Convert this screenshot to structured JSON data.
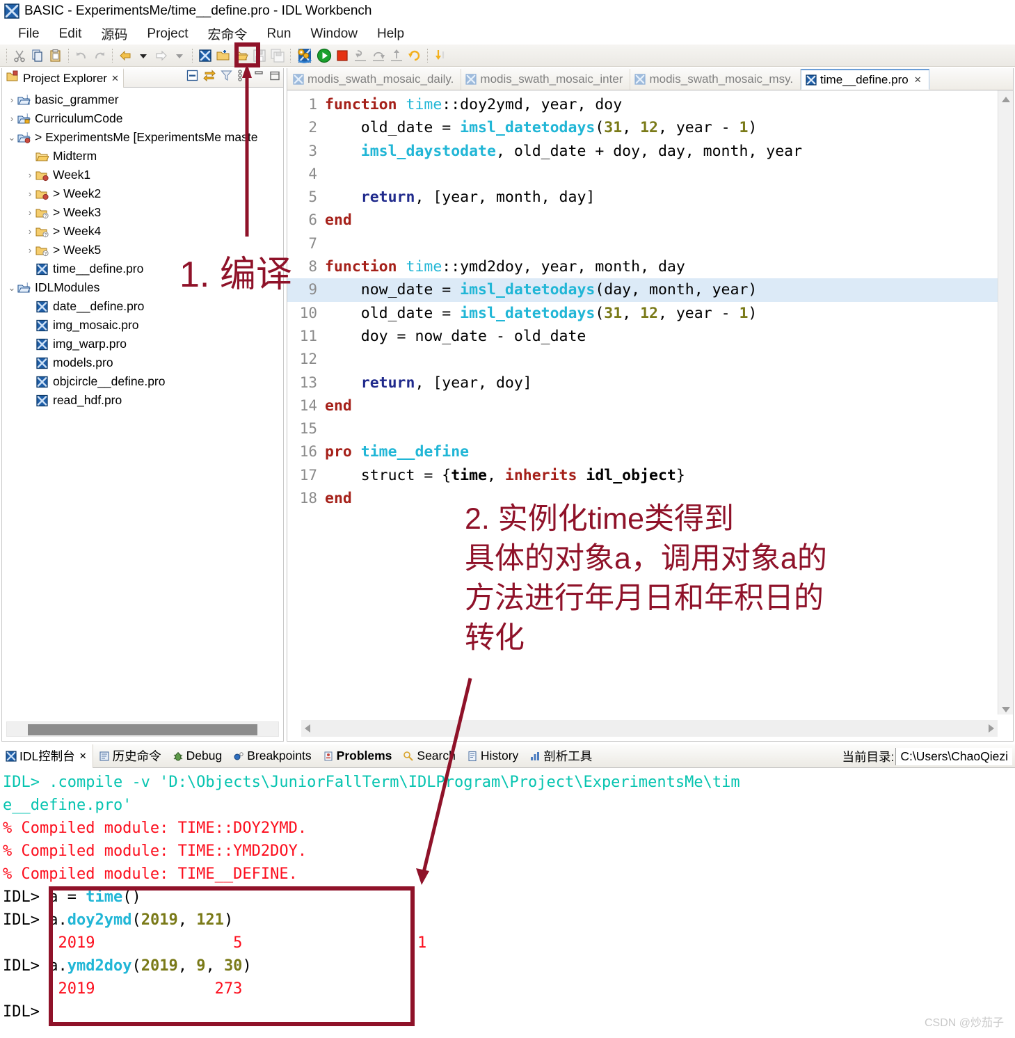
{
  "window": {
    "title": "BASIC - ExperimentsMe/time__define.pro - IDL Workbench",
    "app_icon": "idl-workbench-icon"
  },
  "menubar": {
    "items": [
      {
        "label": "File",
        "name": "menu-file"
      },
      {
        "label": "Edit",
        "name": "menu-edit"
      },
      {
        "label": "源码",
        "name": "menu-source"
      },
      {
        "label": "Project",
        "name": "menu-project"
      },
      {
        "label": "宏命令",
        "name": "menu-macro"
      },
      {
        "label": "Run",
        "name": "menu-run"
      },
      {
        "label": "Window",
        "name": "menu-window"
      },
      {
        "label": "Help",
        "name": "menu-help"
      }
    ]
  },
  "toolbar": {
    "highlight_color": "#8f1229",
    "buttons": [
      {
        "name": "cut-icon"
      },
      {
        "name": "copy-icon"
      },
      {
        "name": "paste-icon"
      },
      {
        "name": "undo-icon"
      },
      {
        "name": "redo-icon"
      },
      {
        "name": "back-arrow-icon"
      },
      {
        "name": "back-dropdown-icon"
      },
      {
        "name": "forward-arrow-icon"
      },
      {
        "name": "forward-dropdown-icon"
      },
      {
        "name": "idl-file-icon"
      },
      {
        "name": "new-project-icon"
      },
      {
        "name": "open-folder-icon"
      },
      {
        "name": "save-icon"
      },
      {
        "name": "save-all-icon"
      },
      {
        "name": "compile-icon"
      },
      {
        "name": "run-icon"
      },
      {
        "name": "stop-icon"
      },
      {
        "name": "step-into-icon"
      },
      {
        "name": "step-over-icon"
      },
      {
        "name": "step-return-icon"
      },
      {
        "name": "reset-icon"
      },
      {
        "name": "download-icon"
      }
    ]
  },
  "explorer": {
    "tab_label": "Project Explorer",
    "tab_close": "✕",
    "toolbar_icons": [
      {
        "name": "collapse-all-icon"
      },
      {
        "name": "link-with-editor-icon"
      },
      {
        "name": "filter-icon"
      },
      {
        "name": "view-menu-icon"
      },
      {
        "name": "minimize-view-icon"
      },
      {
        "name": "maximize-view-icon"
      }
    ],
    "tree": [
      {
        "label": "basic_grammer",
        "arrow": "›",
        "indent": 0,
        "icon": "idl-project-icon"
      },
      {
        "label": "CurriculumCode",
        "arrow": "›",
        "indent": 0,
        "icon": "idl-project-locked-icon"
      },
      {
        "label": "> ExperimentsMe [ExperimentsMe maste",
        "arrow": "⌄",
        "indent": 0,
        "icon": "idl-project-git-icon"
      },
      {
        "label": "Midterm",
        "arrow": "",
        "indent": 1,
        "icon": "folder-icon"
      },
      {
        "label": "Week1",
        "arrow": "›",
        "indent": 1,
        "icon": "folder-git-icon"
      },
      {
        "label": "> Week2",
        "arrow": "›",
        "indent": 1,
        "icon": "folder-git-icon"
      },
      {
        "label": "> Week3",
        "arrow": "›",
        "indent": 1,
        "icon": "folder-git-q-icon"
      },
      {
        "label": "> Week4",
        "arrow": "›",
        "indent": 1,
        "icon": "folder-git-q-icon"
      },
      {
        "label": "> Week5",
        "arrow": "›",
        "indent": 1,
        "icon": "folder-git-q-icon"
      },
      {
        "label": "time__define.pro",
        "arrow": "",
        "indent": 1,
        "icon": "pro-file-icon"
      },
      {
        "label": "IDLModules",
        "arrow": "⌄",
        "indent": 0,
        "icon": "idl-project-icon"
      },
      {
        "label": "date__define.pro",
        "arrow": "",
        "indent": 1,
        "icon": "pro-file-icon"
      },
      {
        "label": "img_mosaic.pro",
        "arrow": "",
        "indent": 1,
        "icon": "pro-file-icon"
      },
      {
        "label": "img_warp.pro",
        "arrow": "",
        "indent": 1,
        "icon": "pro-file-icon"
      },
      {
        "label": "models.pro",
        "arrow": "",
        "indent": 1,
        "icon": "pro-file-icon"
      },
      {
        "label": "objcircle__define.pro",
        "arrow": "",
        "indent": 1,
        "icon": "pro-file-icon"
      },
      {
        "label": "read_hdf.pro",
        "arrow": "",
        "indent": 1,
        "icon": "pro-file-icon"
      }
    ]
  },
  "editor": {
    "tabs": [
      {
        "label": "modis_swath_mosaic_daily.",
        "active": false,
        "close": ""
      },
      {
        "label": "modis_swath_mosaic_inter",
        "active": false,
        "close": ""
      },
      {
        "label": "modis_swath_mosaic_msy.",
        "active": false,
        "close": ""
      },
      {
        "label": "time__define.pro",
        "active": true,
        "close": "✕"
      }
    ],
    "highlight_line": 9,
    "lines": [
      {
        "n": "1",
        "tokens": [
          {
            "t": "function",
            "c": "kw"
          },
          {
            "t": " ",
            "c": ""
          },
          {
            "t": "time",
            "c": "cls"
          },
          {
            "t": "::doy2ymd, year, doy",
            "c": ""
          }
        ]
      },
      {
        "n": "2",
        "tokens": [
          {
            "t": "    old_date = ",
            "c": ""
          },
          {
            "t": "imsl_datetodays",
            "c": "fn"
          },
          {
            "t": "(",
            "c": ""
          },
          {
            "t": "31",
            "c": "num"
          },
          {
            "t": ", ",
            "c": ""
          },
          {
            "t": "12",
            "c": "num"
          },
          {
            "t": ", year - ",
            "c": ""
          },
          {
            "t": "1",
            "c": "num"
          },
          {
            "t": ")",
            "c": ""
          }
        ]
      },
      {
        "n": "3",
        "tokens": [
          {
            "t": "    ",
            "c": ""
          },
          {
            "t": "imsl_daystodate",
            "c": "fn"
          },
          {
            "t": ", old_date + doy, day, month, year",
            "c": ""
          }
        ]
      },
      {
        "n": "4",
        "tokens": [
          {
            "t": "",
            "c": ""
          }
        ]
      },
      {
        "n": "5",
        "tokens": [
          {
            "t": "    ",
            "c": ""
          },
          {
            "t": "return",
            "c": "ret"
          },
          {
            "t": ", [year, month, day]",
            "c": ""
          }
        ]
      },
      {
        "n": "6",
        "tokens": [
          {
            "t": "end",
            "c": "kw"
          }
        ]
      },
      {
        "n": "7",
        "tokens": [
          {
            "t": "",
            "c": ""
          }
        ]
      },
      {
        "n": "8",
        "tokens": [
          {
            "t": "function",
            "c": "kw"
          },
          {
            "t": " ",
            "c": ""
          },
          {
            "t": "time",
            "c": "cls"
          },
          {
            "t": "::ymd2doy, year, month, day",
            "c": ""
          }
        ]
      },
      {
        "n": "9",
        "tokens": [
          {
            "t": "    now_date = ",
            "c": ""
          },
          {
            "t": "imsl_datetodays",
            "c": "fn"
          },
          {
            "t": "(day, month, year)",
            "c": ""
          }
        ]
      },
      {
        "n": "10",
        "tokens": [
          {
            "t": "    old_date = ",
            "c": ""
          },
          {
            "t": "imsl_datetodays",
            "c": "fn"
          },
          {
            "t": "(",
            "c": ""
          },
          {
            "t": "31",
            "c": "num"
          },
          {
            "t": ", ",
            "c": ""
          },
          {
            "t": "12",
            "c": "num"
          },
          {
            "t": ", year - ",
            "c": ""
          },
          {
            "t": "1",
            "c": "num"
          },
          {
            "t": ")",
            "c": ""
          }
        ]
      },
      {
        "n": "11",
        "tokens": [
          {
            "t": "    doy = now_date - old_date",
            "c": ""
          }
        ]
      },
      {
        "n": "12",
        "tokens": [
          {
            "t": "",
            "c": ""
          }
        ]
      },
      {
        "n": "13",
        "tokens": [
          {
            "t": "    ",
            "c": ""
          },
          {
            "t": "return",
            "c": "ret"
          },
          {
            "t": ", [year, doy]",
            "c": ""
          }
        ]
      },
      {
        "n": "14",
        "tokens": [
          {
            "t": "end",
            "c": "kw"
          }
        ]
      },
      {
        "n": "15",
        "tokens": [
          {
            "t": "",
            "c": ""
          }
        ]
      },
      {
        "n": "16",
        "tokens": [
          {
            "t": "pro",
            "c": "kw"
          },
          {
            "t": " ",
            "c": ""
          },
          {
            "t": "time__define",
            "c": "fn"
          }
        ]
      },
      {
        "n": "17",
        "tokens": [
          {
            "t": "    struct = {",
            "c": ""
          },
          {
            "t": "time",
            "c": "bk"
          },
          {
            "t": ", ",
            "c": ""
          },
          {
            "t": "inherits",
            "c": "kw"
          },
          {
            "t": " ",
            "c": ""
          },
          {
            "t": "idl_object",
            "c": "bk"
          },
          {
            "t": "}",
            "c": ""
          }
        ]
      },
      {
        "n": "18",
        "tokens": [
          {
            "t": "end",
            "c": "kw"
          }
        ]
      }
    ]
  },
  "bottom_panel": {
    "tabs": [
      {
        "label": "IDL控制台",
        "icon": "idl-console-icon",
        "active": true,
        "bold": false,
        "close": "✕"
      },
      {
        "label": "历史命令",
        "icon": "history-cmd-icon",
        "active": false,
        "bold": false,
        "close": ""
      },
      {
        "label": "Debug",
        "icon": "debug-icon",
        "active": false,
        "bold": false,
        "close": ""
      },
      {
        "label": "Breakpoints",
        "icon": "breakpoint-icon",
        "active": false,
        "bold": false,
        "close": ""
      },
      {
        "label": "Problems",
        "icon": "problems-icon",
        "active": false,
        "bold": true,
        "close": ""
      },
      {
        "label": "Search",
        "icon": "search-icon",
        "active": false,
        "bold": false,
        "close": ""
      },
      {
        "label": "History",
        "icon": "history-icon",
        "active": false,
        "bold": false,
        "close": ""
      },
      {
        "label": "剖析工具",
        "icon": "profiler-icon",
        "active": false,
        "bold": false,
        "close": ""
      }
    ],
    "cwd_label": "当前目录:",
    "cwd_value": "C:\\Users\\ChaoQiezi"
  },
  "console": {
    "lines": [
      {
        "segments": [
          {
            "t": "IDL> ",
            "c": "c-cmd"
          },
          {
            "t": ".compile -v 'D:\\Objects\\JuniorFallTerm\\IDLProgram\\Project\\ExperimentsMe\\tim",
            "c": "c-cmd"
          }
        ]
      },
      {
        "segments": [
          {
            "t": "e__define.pro'",
            "c": "c-cmd"
          }
        ]
      },
      {
        "segments": [
          {
            "t": "% Compiled module: TIME::DOY2YMD.",
            "c": "c-msg"
          }
        ]
      },
      {
        "segments": [
          {
            "t": "% Compiled module: TIME::YMD2DOY.",
            "c": "c-msg"
          }
        ]
      },
      {
        "segments": [
          {
            "t": "% Compiled module: TIME__DEFINE.",
            "c": "c-msg"
          }
        ]
      },
      {
        "segments": [
          {
            "t": "IDL> ",
            "c": "c-prompt"
          },
          {
            "t": "a = ",
            "c": "c-plain"
          },
          {
            "t": "time",
            "c": "c-cyan"
          },
          {
            "t": "()",
            "c": "c-plain"
          }
        ]
      },
      {
        "segments": [
          {
            "t": "IDL> ",
            "c": "c-prompt"
          },
          {
            "t": "a.",
            "c": "c-plain"
          },
          {
            "t": "doy2ymd",
            "c": "c-cyan"
          },
          {
            "t": "(",
            "c": "c-plain"
          },
          {
            "t": "2019",
            "c": "c-num"
          },
          {
            "t": ", ",
            "c": "c-plain"
          },
          {
            "t": "121",
            "c": "c-num"
          },
          {
            "t": ")",
            "c": "c-plain"
          }
        ]
      },
      {
        "segments": [
          {
            "t": "      2019               5                   1",
            "c": "c-out"
          }
        ]
      },
      {
        "segments": [
          {
            "t": "IDL> ",
            "c": "c-prompt"
          },
          {
            "t": "a.",
            "c": "c-plain"
          },
          {
            "t": "ymd2doy",
            "c": "c-cyan"
          },
          {
            "t": "(",
            "c": "c-plain"
          },
          {
            "t": "2019",
            "c": "c-num"
          },
          {
            "t": ", ",
            "c": "c-plain"
          },
          {
            "t": "9",
            "c": "c-num"
          },
          {
            "t": ", ",
            "c": "c-plain"
          },
          {
            "t": "30",
            "c": "c-num"
          },
          {
            "t": ")",
            "c": "c-plain"
          }
        ]
      },
      {
        "segments": [
          {
            "t": "      2019             273",
            "c": "c-out"
          }
        ]
      },
      {
        "segments": [
          {
            "t": "IDL> ",
            "c": "c-prompt"
          }
        ]
      }
    ]
  },
  "annotations": {
    "color": "#8f1229",
    "note1": "1. 编译",
    "note2": "2. 实例化time类得到\n具体的对象a，调用对象a的\n方法进行年月日和年积日的\n转化"
  },
  "watermark": "CSDN @炒茄子"
}
